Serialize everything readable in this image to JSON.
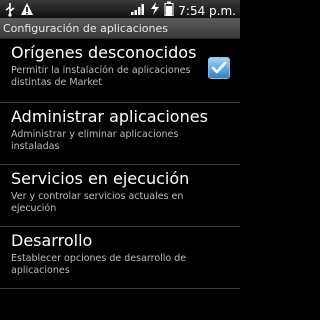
{
  "status_bar": {
    "time": "7:54 p.m.",
    "icons": [
      "usb-icon",
      "warning-icon",
      "signal-icon",
      "charging-icon",
      "battery-icon"
    ]
  },
  "header": {
    "title": "Configuración de aplicaciones"
  },
  "items": [
    {
      "title": "Orígenes desconocidos",
      "subtitle": "Permitir la instalación de aplicaciones distintas de Market",
      "checked": true
    },
    {
      "title": "Administrar aplicaciones",
      "subtitle": "Administrar y eliminar aplicaciones instaladas"
    },
    {
      "title": "Servicios en ejecución",
      "subtitle": "Ver y controlar servicios actuales en ejecución"
    },
    {
      "title": "Desarrollo",
      "subtitle": "Establecer opciones de desarrollo de aplicaciones"
    }
  ],
  "colors": {
    "checkbox": "#2c7fd0",
    "background": "#000000"
  }
}
